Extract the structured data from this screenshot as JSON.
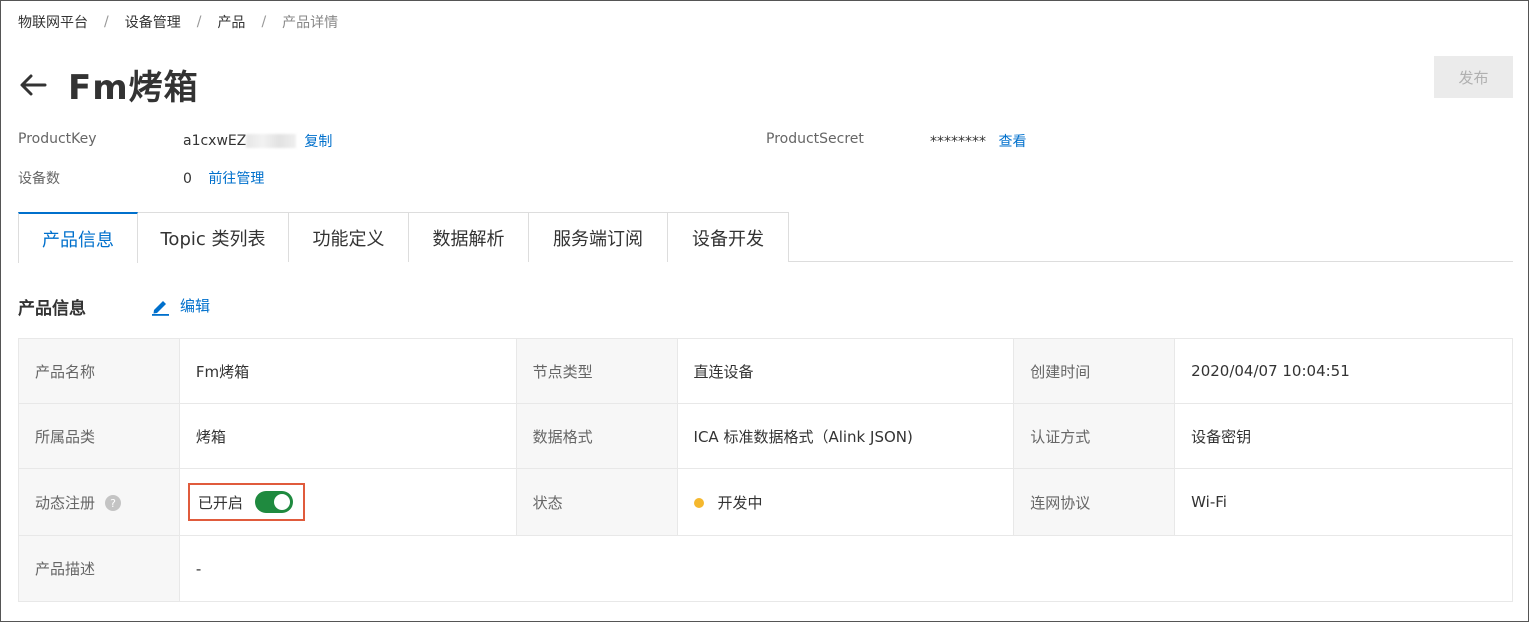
{
  "breadcrumb": [
    "物联网平台",
    "设备管理",
    "产品",
    "产品详情"
  ],
  "page": {
    "title": "Fm烤箱",
    "publish_label": "发布"
  },
  "meta": {
    "product_key_label": "ProductKey",
    "product_key_value": "a1cxwEZ",
    "copy_label": "复制",
    "product_secret_label": "ProductSecret",
    "product_secret_value": "********",
    "view_label": "查看",
    "device_count_label": "设备数",
    "device_count_value": "0",
    "manage_label": "前往管理"
  },
  "tabs": [
    "产品信息",
    "Topic 类列表",
    "功能定义",
    "数据解析",
    "服务端订阅",
    "设备开发"
  ],
  "section": {
    "title": "产品信息",
    "edit_label": "编辑"
  },
  "info": {
    "product_name_label": "产品名称",
    "product_name": "Fm烤箱",
    "node_type_label": "节点类型",
    "node_type": "直连设备",
    "created_label": "创建时间",
    "created": "2020/04/07 10:04:51",
    "category_label": "所属品类",
    "category": "烤箱",
    "data_format_label": "数据格式",
    "data_format": "ICA 标准数据格式（Alink JSON)",
    "auth_label": "认证方式",
    "auth": "设备密钥",
    "dynamic_reg_label": "动态注册",
    "help_glyph": "?",
    "dynamic_reg_status": "已开启",
    "status_label": "状态",
    "status": "开发中",
    "protocol_label": "连网协议",
    "protocol": "Wi-Fi",
    "description_label": "产品描述",
    "description": "-"
  },
  "colors": {
    "link": "#0070cc",
    "toggle_on": "#1f8a3f",
    "status_dot": "#f5b82e",
    "highlight_box": "#e05b3c"
  }
}
